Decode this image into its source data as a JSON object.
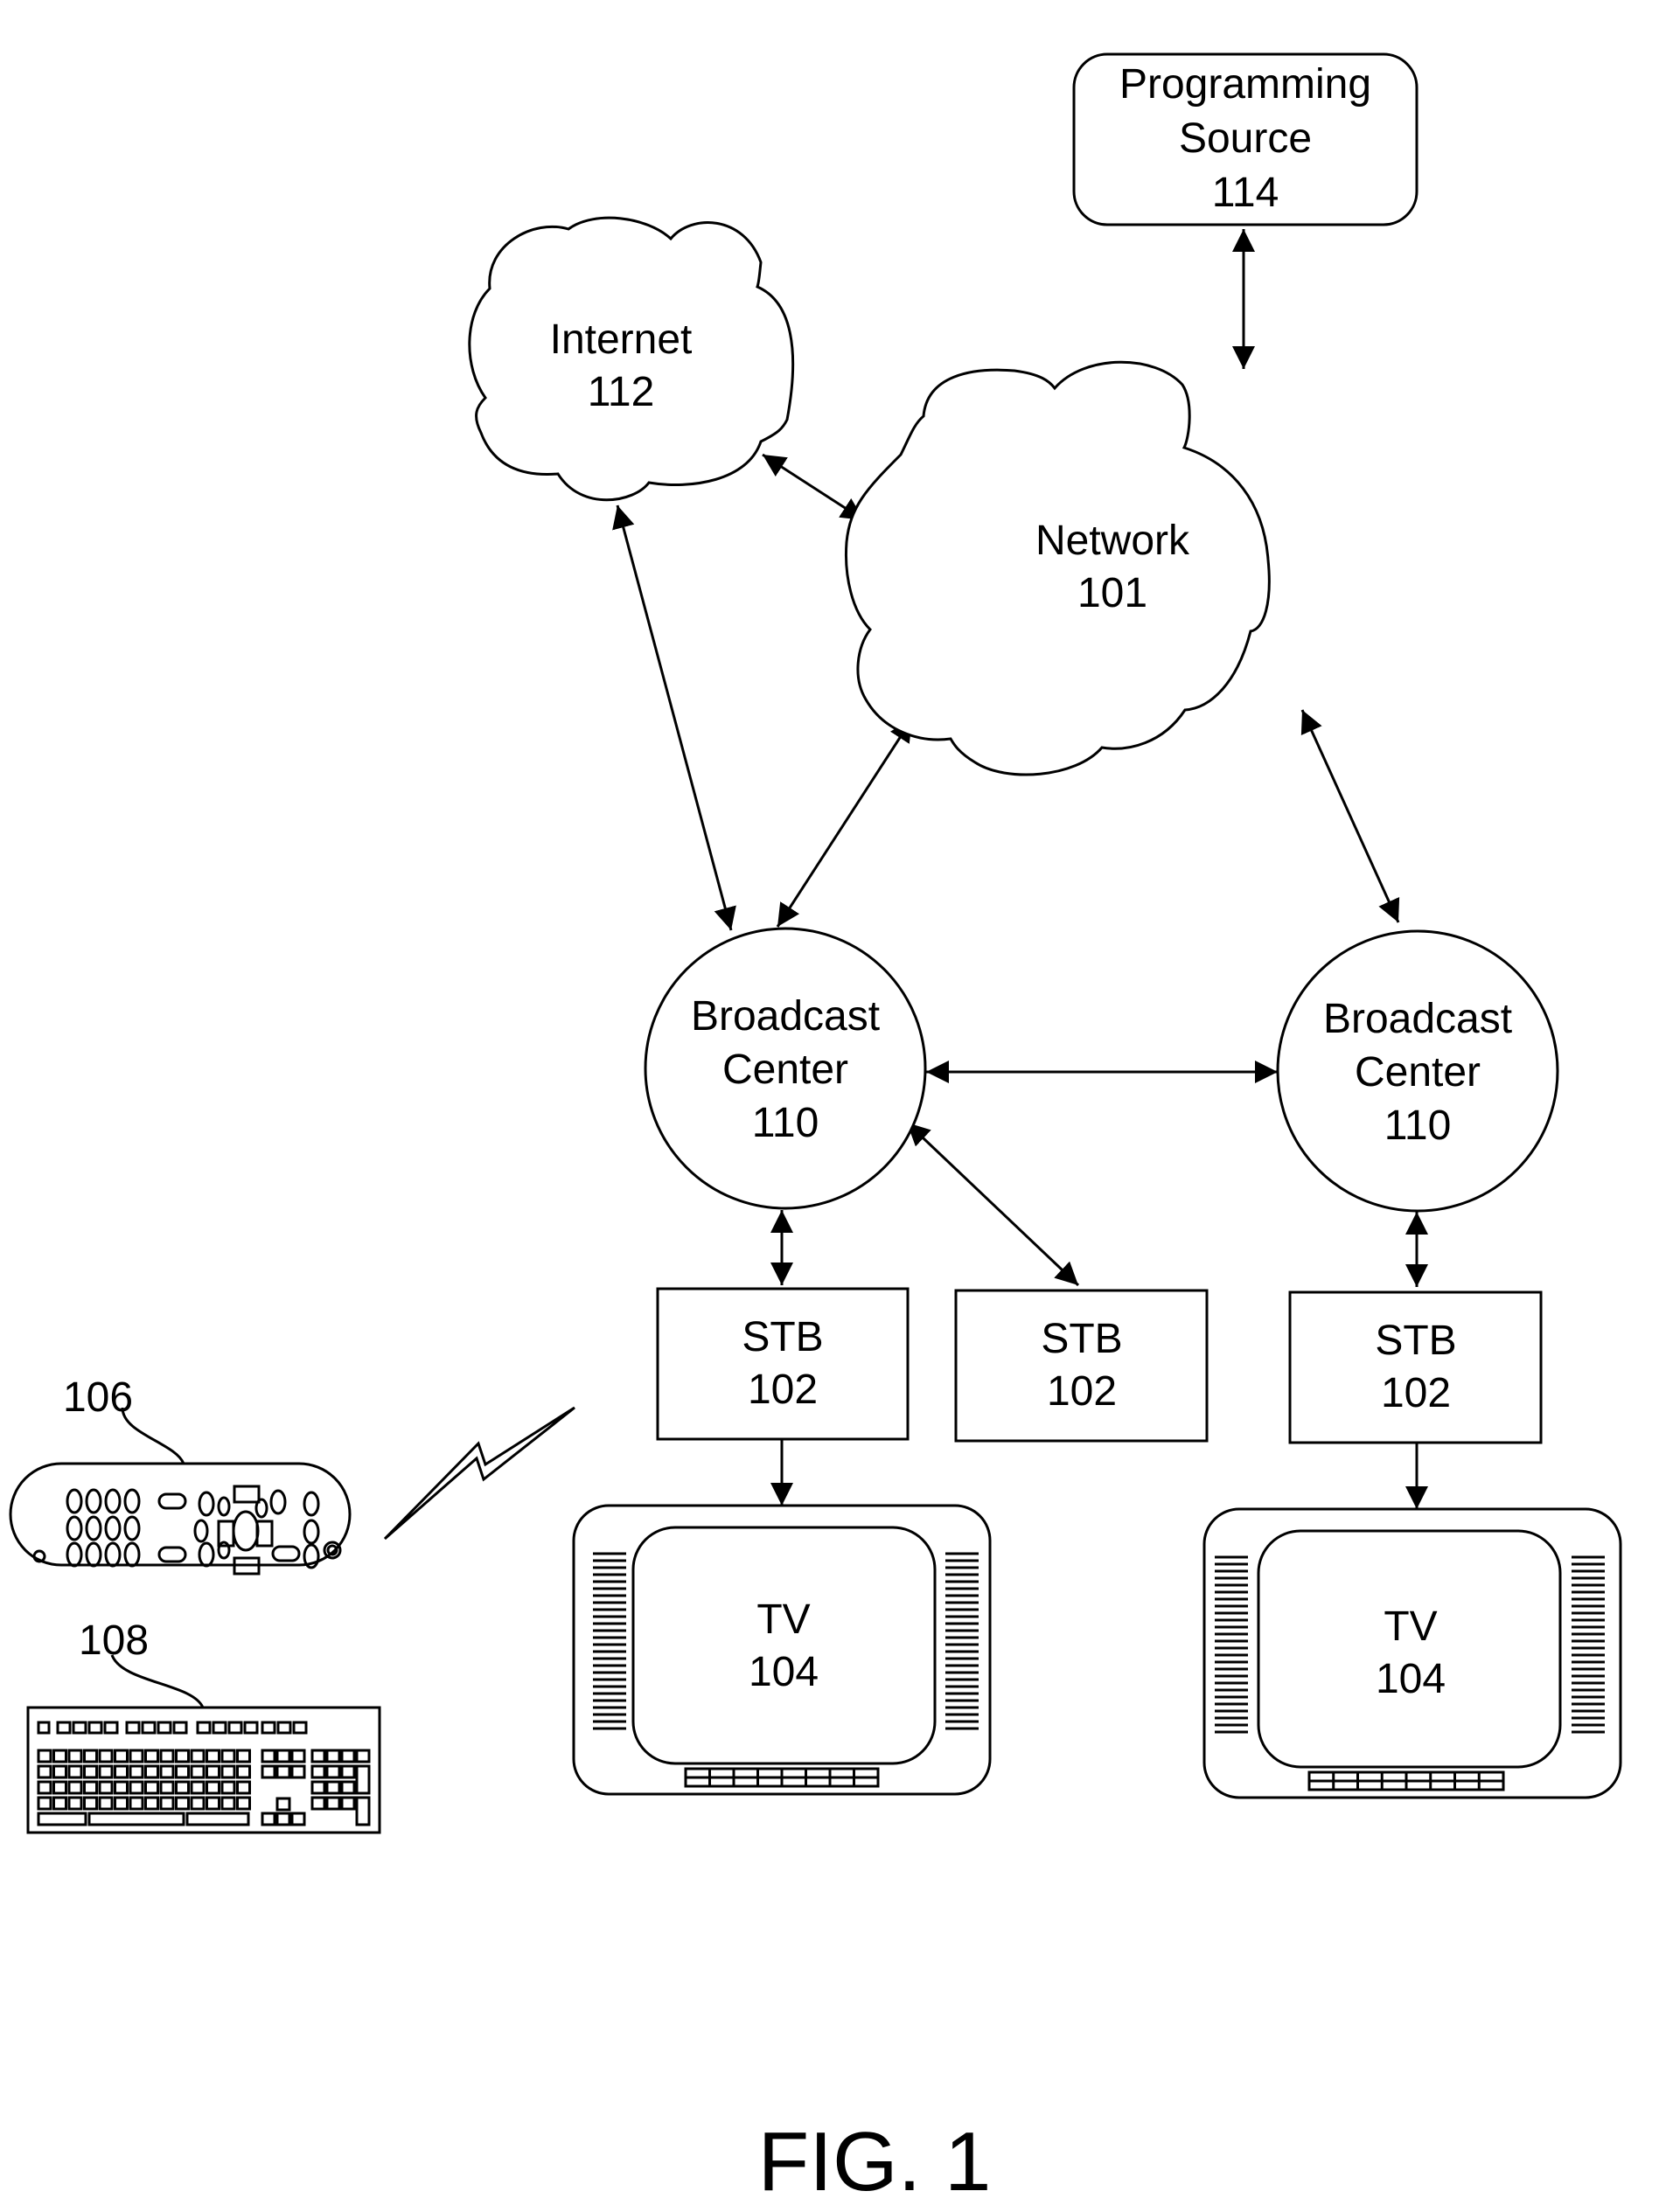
{
  "figure_label": "FIG. 1",
  "nodes": {
    "programming_source": {
      "line1": "Programming",
      "line2": "Source",
      "ref": "114"
    },
    "internet": {
      "line1": "Internet",
      "ref": "112"
    },
    "network": {
      "line1": "Network",
      "ref": "101"
    },
    "broadcast_center_left": {
      "line1": "Broadcast",
      "line2": "Center",
      "ref": "110"
    },
    "broadcast_center_right": {
      "line1": "Broadcast",
      "line2": "Center",
      "ref": "110"
    },
    "stb_left": {
      "line1": "STB",
      "ref": "102"
    },
    "stb_middle": {
      "line1": "STB",
      "ref": "102"
    },
    "stb_right": {
      "line1": "STB",
      "ref": "102"
    },
    "tv_left": {
      "line1": "TV",
      "ref": "104"
    },
    "tv_right": {
      "line1": "TV",
      "ref": "104"
    },
    "remote": {
      "ref": "106"
    },
    "keyboard": {
      "ref": "108"
    }
  },
  "connections": [
    {
      "from": "programming_source",
      "to": "network",
      "type": "bidirectional"
    },
    {
      "from": "internet",
      "to": "network",
      "type": "bidirectional"
    },
    {
      "from": "internet",
      "to": "broadcast_center_left",
      "type": "bidirectional"
    },
    {
      "from": "network",
      "to": "broadcast_center_left",
      "type": "bidirectional"
    },
    {
      "from": "network",
      "to": "broadcast_center_right",
      "type": "bidirectional"
    },
    {
      "from": "broadcast_center_left",
      "to": "broadcast_center_right",
      "type": "bidirectional"
    },
    {
      "from": "broadcast_center_left",
      "to": "stb_left",
      "type": "bidirectional"
    },
    {
      "from": "broadcast_center_left",
      "to": "stb_middle",
      "type": "bidirectional"
    },
    {
      "from": "broadcast_center_right",
      "to": "stb_right",
      "type": "bidirectional"
    },
    {
      "from": "stb_left",
      "to": "tv_left",
      "type": "directed"
    },
    {
      "from": "stb_right",
      "to": "tv_right",
      "type": "directed"
    },
    {
      "from": "remote",
      "to": "stb_left",
      "type": "wireless"
    }
  ]
}
